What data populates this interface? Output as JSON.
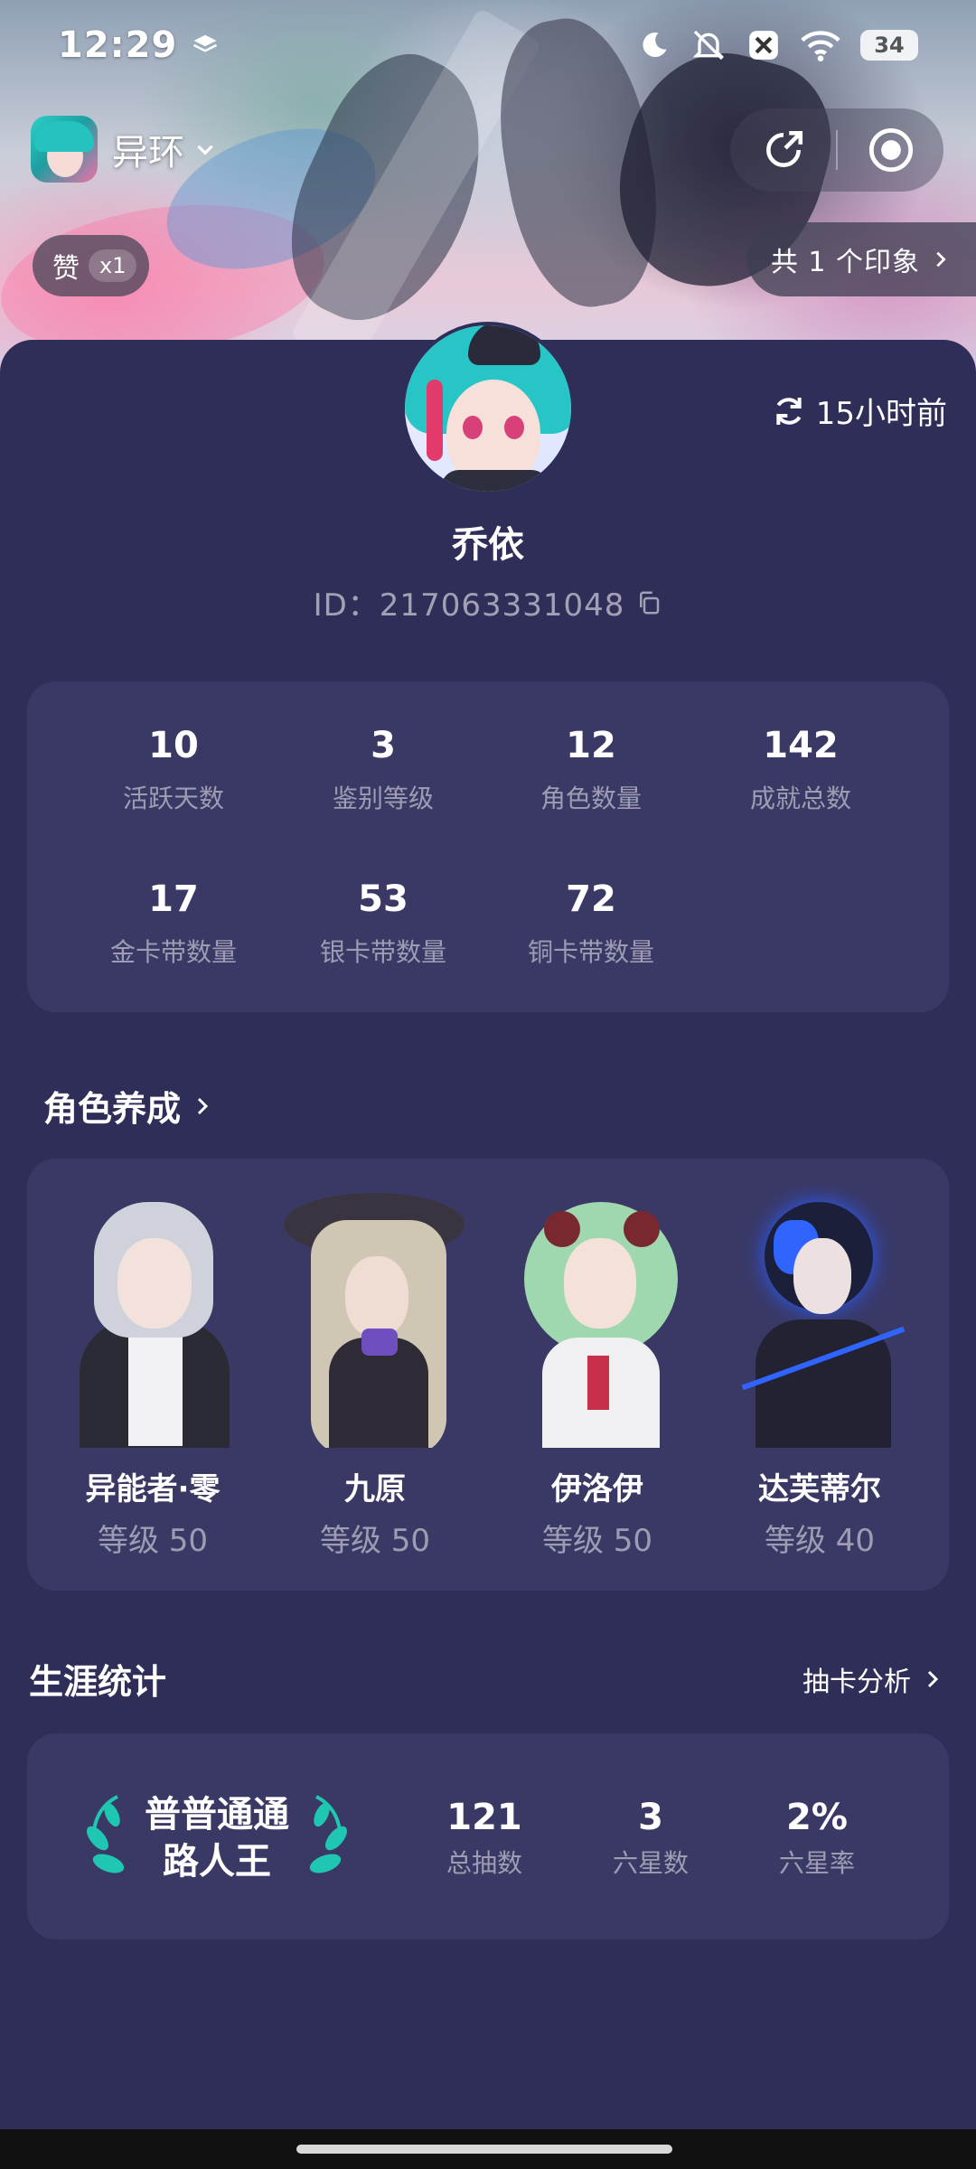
{
  "status_bar": {
    "time": "12:29",
    "battery": "34"
  },
  "header": {
    "game_name": "异环",
    "like_label": "赞",
    "like_count": "x1",
    "impression_label": "共 1 个印象"
  },
  "profile": {
    "refresh_time": "15小时前",
    "username": "乔依",
    "user_id": "ID：217063331048"
  },
  "stats": [
    {
      "value": "10",
      "label": "活跃天数"
    },
    {
      "value": "3",
      "label": "鉴别等级"
    },
    {
      "value": "12",
      "label": "角色数量"
    },
    {
      "value": "142",
      "label": "成就总数"
    },
    {
      "value": "17",
      "label": "金卡带数量"
    },
    {
      "value": "53",
      "label": "银卡带数量"
    },
    {
      "value": "72",
      "label": "铜卡带数量"
    }
  ],
  "roles_section": {
    "title": "角色养成",
    "roles": [
      {
        "name": "异能者·零",
        "level": "等级 50"
      },
      {
        "name": "九原",
        "level": "等级 50"
      },
      {
        "name": "伊洛伊",
        "level": "等级 50"
      },
      {
        "name": "达芙蒂尔",
        "level": "等级 40"
      }
    ]
  },
  "career_section": {
    "title": "生涯统计",
    "link": "抽卡分析",
    "rank_title_line1": "普普通通",
    "rank_title_line2": "路人王",
    "stats": [
      {
        "value": "121",
        "label": "总抽数"
      },
      {
        "value": "3",
        "label": "六星数"
      },
      {
        "value": "2%",
        "label": "六星率"
      }
    ]
  },
  "colors": {
    "background": "#2f2e59",
    "card": "#3a3966",
    "laurel": "#1fc7b2"
  }
}
